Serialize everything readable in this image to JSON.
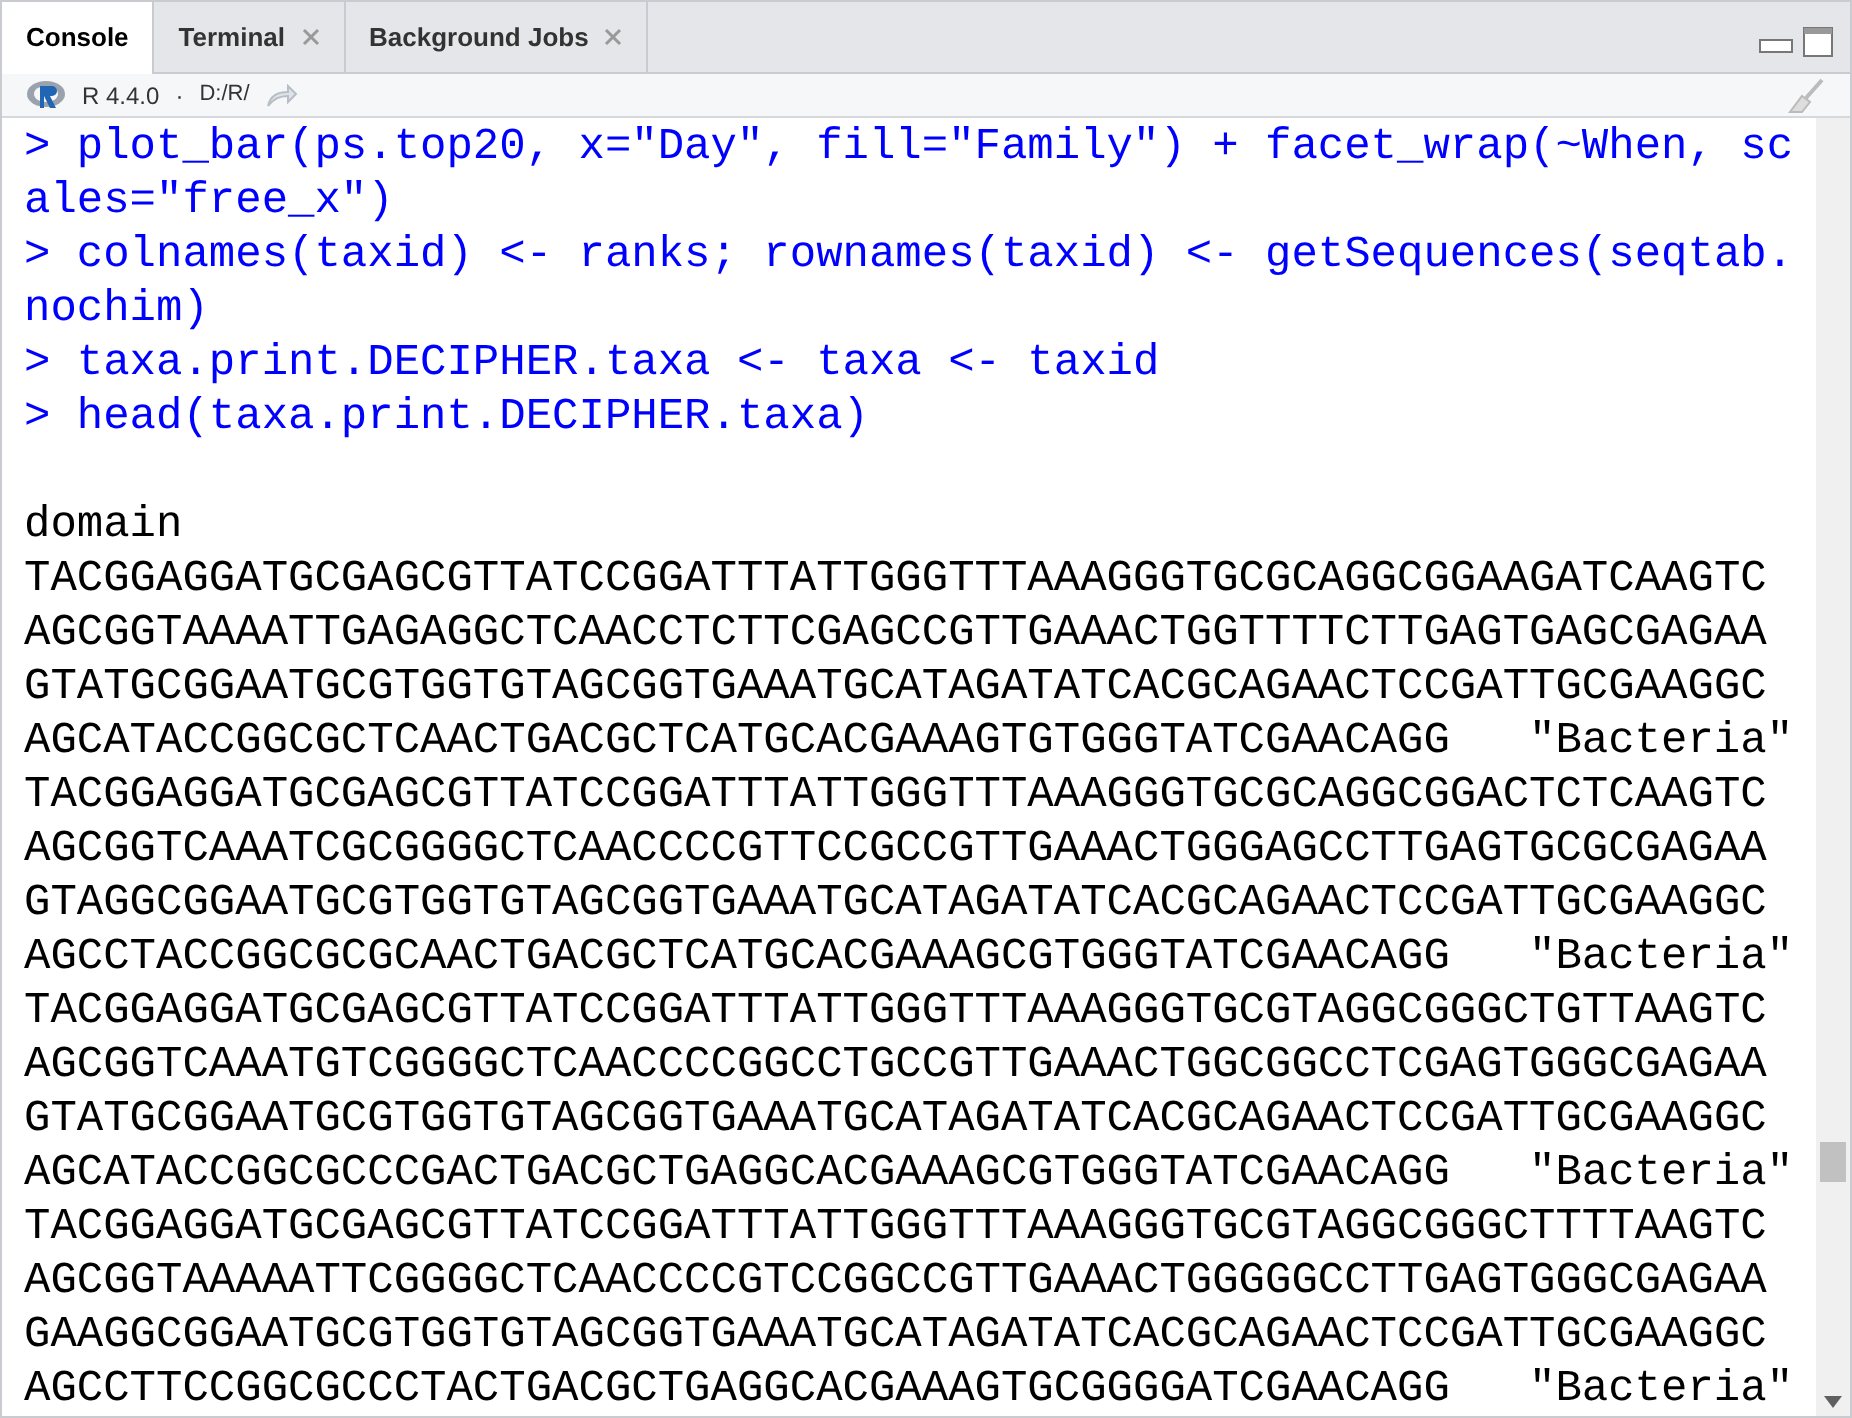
{
  "tabs": [
    {
      "label": "Console",
      "selected": true,
      "closable": false
    },
    {
      "label": "Terminal",
      "selected": false,
      "closable": true
    },
    {
      "label": "Background Jobs",
      "selected": false,
      "closable": true
    }
  ],
  "toolbar": {
    "version": "R 4.4.0",
    "separator": "·",
    "path": "D:/R/"
  },
  "console": {
    "lines": [
      {
        "kind": "command",
        "prompt": ">",
        "text": "plot_bar(ps.top20, x=\"Day\", fill=\"Family\") + facet_wrap(~When, scales=\"free_x\")"
      },
      {
        "kind": "command",
        "prompt": ">",
        "text": "colnames(taxid) <- ranks; rownames(taxid) <- getSequences(seqtab.nochim)"
      },
      {
        "kind": "command",
        "prompt": ">",
        "text": "taxa.print.DECIPHER.taxa <- taxa <- taxid"
      },
      {
        "kind": "command",
        "prompt": ">",
        "text": "head(taxa.print.DECIPHER.taxa)"
      },
      {
        "kind": "blank"
      },
      {
        "kind": "output",
        "text": "domain"
      },
      {
        "kind": "row",
        "text": "TACGGAGGATGCGAGCGTTATCCGGATTTATTGGGTTTAAAGGGTGCGCAGGCGGAAGATCAAGTC"
      },
      {
        "kind": "row",
        "text": "AGCGGTAAAATTGAGAGGCTCAACCTCTTCGAGCCGTTGAAACTGGTTTTCTTGAGTGAGCGAGAA"
      },
      {
        "kind": "row",
        "text": "GTATGCGGAATGCGTGGTGTAGCGGTGAAATGCATAGATATCACGCAGAACTCCGATTGCGAAGGC"
      },
      {
        "kind": "row",
        "text": "AGCATACCGGCGCTCAACTGACGCTCATGCACGAAAGTGTGGGTATCGAACAGG",
        "value": "\"Bacteria\""
      },
      {
        "kind": "row",
        "text": "TACGGAGGATGCGAGCGTTATCCGGATTTATTGGGTTTAAAGGGTGCGCAGGCGGACTCTCAAGTC"
      },
      {
        "kind": "row",
        "text": "AGCGGTCAAATCGCGGGGCTCAACCCCGTTCCGCCGTTGAAACTGGGAGCCTTGAGTGCGCGAGAA"
      },
      {
        "kind": "row",
        "text": "GTAGGCGGAATGCGTGGTGTAGCGGTGAAATGCATAGATATCACGCAGAACTCCGATTGCGAAGGC"
      },
      {
        "kind": "row",
        "text": "AGCCTACCGGCGCGCAACTGACGCTCATGCACGAAAGCGTGGGTATCGAACAGG",
        "value": "\"Bacteria\""
      },
      {
        "kind": "row",
        "text": "TACGGAGGATGCGAGCGTTATCCGGATTTATTGGGTTTAAAGGGTGCGTAGGCGGGCTGTTAAGTC"
      },
      {
        "kind": "row",
        "text": "AGCGGTCAAATGTCGGGGCTCAACCCCGGCCTGCCGTTGAAACTGGCGGCCTCGAGTGGGCGAGAA"
      },
      {
        "kind": "row",
        "text": "GTATGCGGAATGCGTGGTGTAGCGGTGAAATGCATAGATATCACGCAGAACTCCGATTGCGAAGGC"
      },
      {
        "kind": "row",
        "text": "AGCATACCGGCGCCCGACTGACGCTGAGGCACGAAAGCGTGGGTATCGAACAGG",
        "value": "\"Bacteria\""
      },
      {
        "kind": "row",
        "text": "TACGGAGGATGCGAGCGTTATCCGGATTTATTGGGTTTAAAGGGTGCGTAGGCGGGCTTTTAAGTC"
      },
      {
        "kind": "row",
        "text": "AGCGGTAAAAATTCGGGGCTCAACCCCGTCCGGCCGTTGAAACTGGGGGCCTTGAGTGGGCGAGAA"
      },
      {
        "kind": "row",
        "text": "GAAGGCGGAATGCGTGGTGTAGCGGTGAAATGCATAGATATCACGCAGAACTCCGATTGCGAAGGC"
      },
      {
        "kind": "row",
        "text": "AGCCTTCCGGCGCCCTACTGACGCTGAGGCACGAAAGTGCGGGGATCGAACAGG",
        "value": "\"Bacteria\""
      }
    ]
  }
}
